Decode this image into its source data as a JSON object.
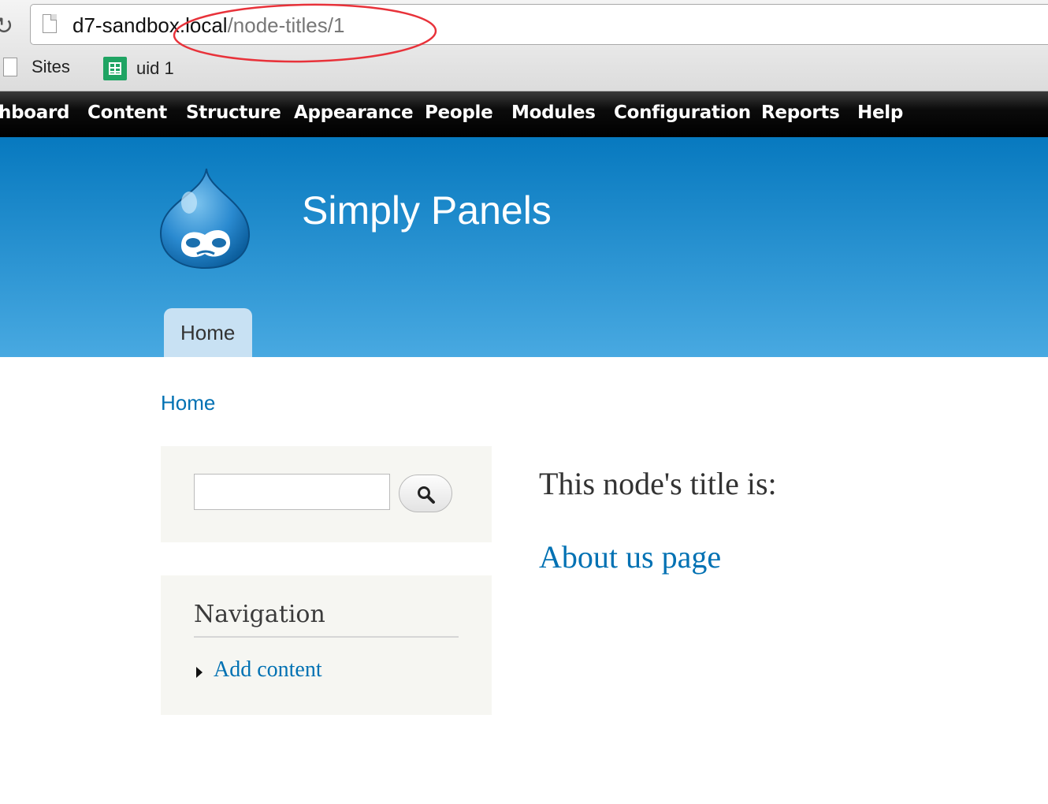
{
  "browser": {
    "url_host": "d7-sandbox.local",
    "url_path": "/node-titles/1",
    "bookmarks": [
      {
        "label": "Sites",
        "icon": "page-icon"
      },
      {
        "label": "uid 1",
        "icon": "spreadsheet-icon"
      }
    ],
    "annotation_color": "#e8323a"
  },
  "admin_toolbar": {
    "items": [
      "hboard",
      "Content",
      "Structure",
      "Appearance",
      "People",
      "Modules",
      "Configuration",
      "Reports",
      "Help"
    ]
  },
  "header": {
    "site_name": "Simply Panels",
    "logo": "drupal-drop-logo",
    "tabs": [
      {
        "label": "Home",
        "active": true
      }
    ]
  },
  "breadcrumb": "Home",
  "sidebar": {
    "search": {
      "input_value": "",
      "button_icon": "magnifier-icon"
    },
    "navigation": {
      "title": "Navigation",
      "items": [
        {
          "label": "Add content"
        }
      ]
    }
  },
  "main": {
    "heading": "This node's title is:",
    "node_title": "About us page"
  },
  "colors": {
    "link": "#0071b3",
    "header_top": "#0779bf",
    "header_bottom": "#48a9e1",
    "toolbar": "#000000",
    "sidebar_block": "#f6f6f2"
  }
}
